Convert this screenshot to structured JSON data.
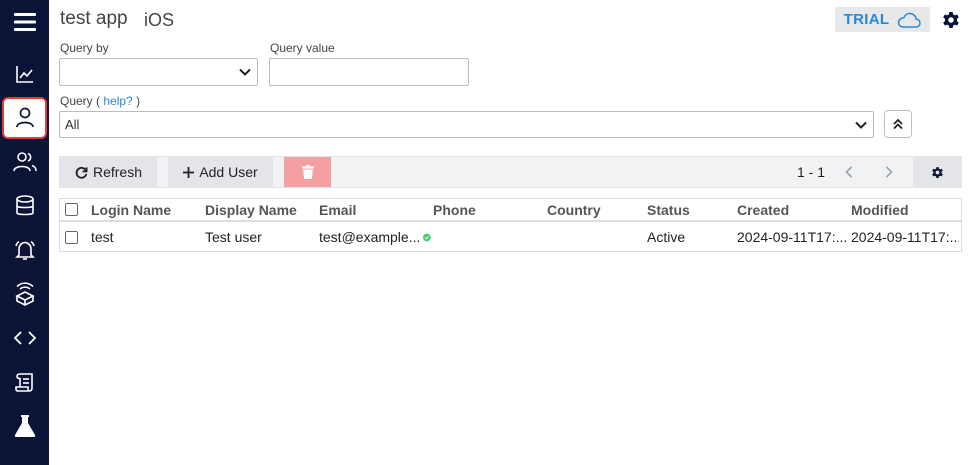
{
  "header": {
    "app_title": "test app",
    "platform": "iOS",
    "plan_badge": "TRIAL",
    "accent_color": "#2b87d8",
    "sidebar_color": "#0b1436"
  },
  "sidebar": {
    "items": [
      {
        "icon": "menu-icon"
      },
      {
        "icon": "chart-line-icon"
      },
      {
        "icon": "user-icon",
        "active": true
      },
      {
        "icon": "users-icon"
      },
      {
        "icon": "database-icon"
      },
      {
        "icon": "bell-icon"
      },
      {
        "icon": "package-icon"
      },
      {
        "icon": "code-icon"
      },
      {
        "icon": "scroll-icon"
      },
      {
        "icon": "flask-icon"
      }
    ]
  },
  "query": {
    "query_by_label": "Query by",
    "query_by_value": "",
    "query_value_label": "Query value",
    "query_value": "",
    "query_label_prefix": "Query (",
    "help_link": "help?",
    "query_label_suffix": ")",
    "query_select_value": "All"
  },
  "toolbar": {
    "refresh_label": "Refresh",
    "add_user_label": "Add User",
    "pagination": "1 - 1",
    "delete_color": "#f4a0a0"
  },
  "table": {
    "columns": [
      "Login Name",
      "Display Name",
      "Email",
      "Phone",
      "Country",
      "Status",
      "Created",
      "Modified"
    ],
    "rows": [
      {
        "login_name": "test",
        "display_name": "Test user",
        "email": "test@example...",
        "email_verified": true,
        "phone": "",
        "country": "",
        "status": "Active",
        "created": "2024-09-11T17:...",
        "modified": "2024-09-11T17:..."
      }
    ]
  }
}
